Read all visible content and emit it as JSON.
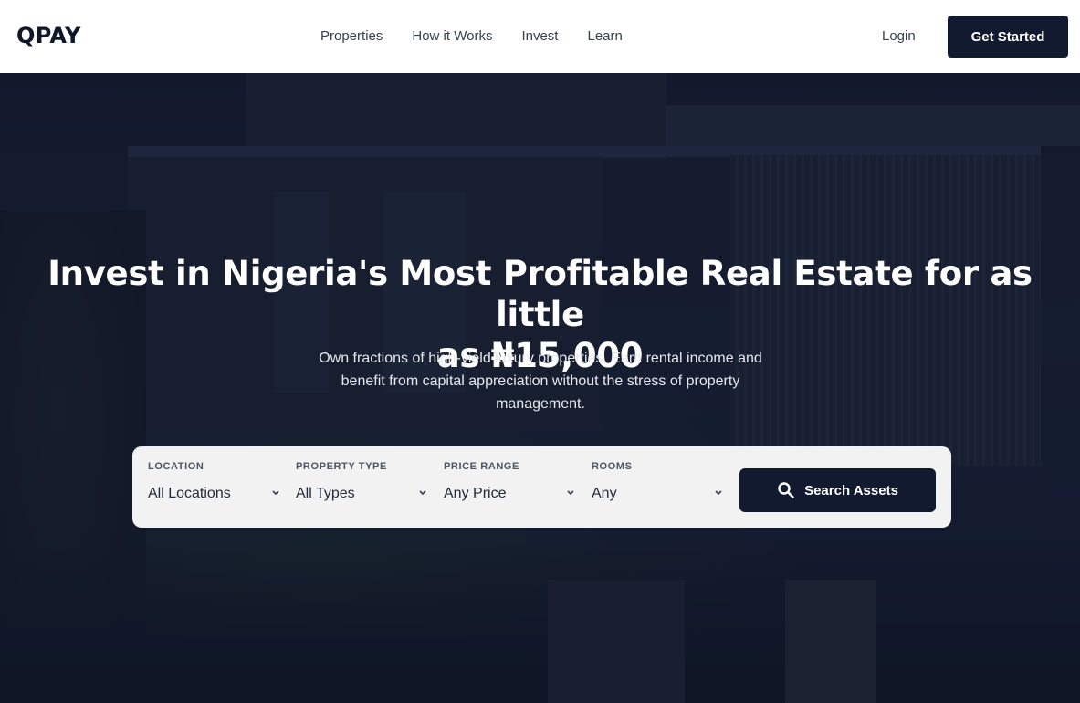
{
  "header": {
    "logo": "QPAY",
    "nav": [
      "Properties",
      "How it Works",
      "Invest",
      "Learn"
    ],
    "login_label": "Login",
    "cta_label": "Get Started"
  },
  "hero": {
    "headline_line1": "Invest in Nigeria's Most Profitable Real Estate for as little",
    "headline_line2": "as ₦15,000",
    "subtext": "Own fractions of high-yield luxury properties. Earn rental income and benefit from capital appreciation without the stress of property management."
  },
  "search": {
    "filters": [
      {
        "label": "LOCATION",
        "value": "All Locations"
      },
      {
        "label": "PROPERTY TYPE",
        "value": "All Types"
      },
      {
        "label": "PRICE RANGE",
        "value": "Any Price"
      },
      {
        "label": "ROOMS",
        "value": "Any"
      }
    ],
    "button_label": "Search Assets",
    "button_icon": "search-icon"
  },
  "colors": {
    "primary_dark": "#111a2e",
    "panel_bg": "#f2f2f2",
    "hero_overlay": "#161d30"
  }
}
